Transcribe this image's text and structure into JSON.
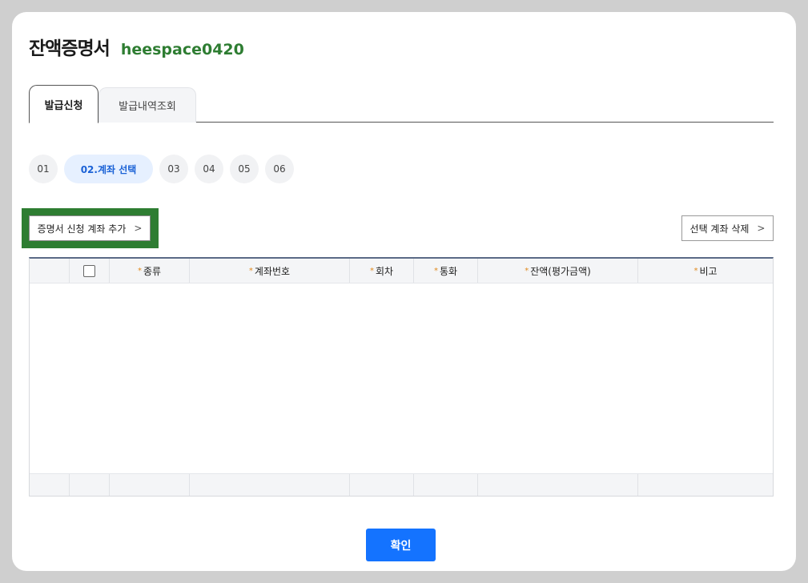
{
  "header": {
    "title": "잔액증명서",
    "user_id": "heespace0420"
  },
  "tabs": [
    {
      "label": "발급신청",
      "active": true
    },
    {
      "label": "발급내역조회",
      "active": false
    }
  ],
  "steps": [
    {
      "label": "01"
    },
    {
      "label": "02.계좌 선택",
      "active": true
    },
    {
      "label": "03"
    },
    {
      "label": "04"
    },
    {
      "label": "05"
    },
    {
      "label": "06"
    }
  ],
  "toolbar": {
    "add_label": "증명서 신청 계좌 추가",
    "delete_label": "선택 계좌 삭제",
    "chevron": ">"
  },
  "table": {
    "required_mark": "*",
    "columns": [
      "종류",
      "계좌번호",
      "회차",
      "통화",
      "잔액(평가금액)",
      "비고"
    ],
    "rows": []
  },
  "footer": {
    "confirm_label": "확인"
  },
  "colors": {
    "accent": "#1473ff",
    "highlight": "#2e7d32",
    "user_id": "#2e7d32",
    "required": "#e08a1e"
  }
}
